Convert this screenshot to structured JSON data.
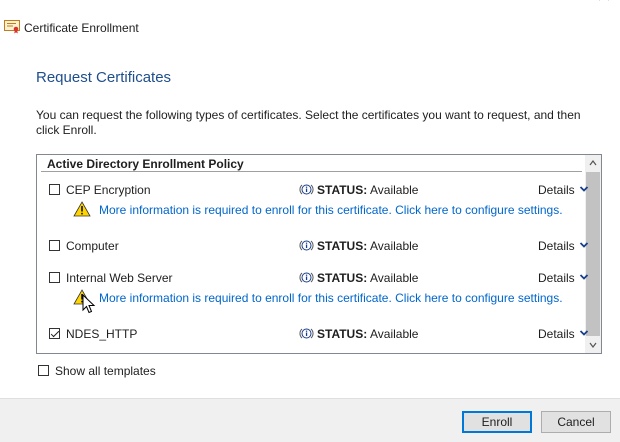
{
  "window": {
    "title": "Certificate Enrollment",
    "title_icon": "certificate-icon"
  },
  "page": {
    "heading": "Request Certificates",
    "intro": "You can request the following types of certificates. Select the certificates you want to request, and then click Enroll."
  },
  "policy": {
    "header": "Active Directory Enrollment Policy",
    "status_label": "STATUS:",
    "details_label": "Details",
    "items": [
      {
        "name": "CEP Encryption",
        "checked": false,
        "status": "Available",
        "warning": "More information is required to enroll for this certificate. Click here to configure settings."
      },
      {
        "name": "Computer",
        "checked": false,
        "status": "Available"
      },
      {
        "name": "Internal Web Server",
        "checked": false,
        "status": "Available",
        "warning": "More information is required to enroll for this certificate. Click here to configure settings."
      },
      {
        "name": "NDES_HTTP",
        "checked": true,
        "status": "Available"
      }
    ]
  },
  "show_all": {
    "label": "Show all templates",
    "checked": false
  },
  "buttons": {
    "enroll": "Enroll",
    "cancel": "Cancel"
  },
  "colors": {
    "heading": "#1f4e8c",
    "link": "#0066cc",
    "focus_border": "#0078d7"
  }
}
